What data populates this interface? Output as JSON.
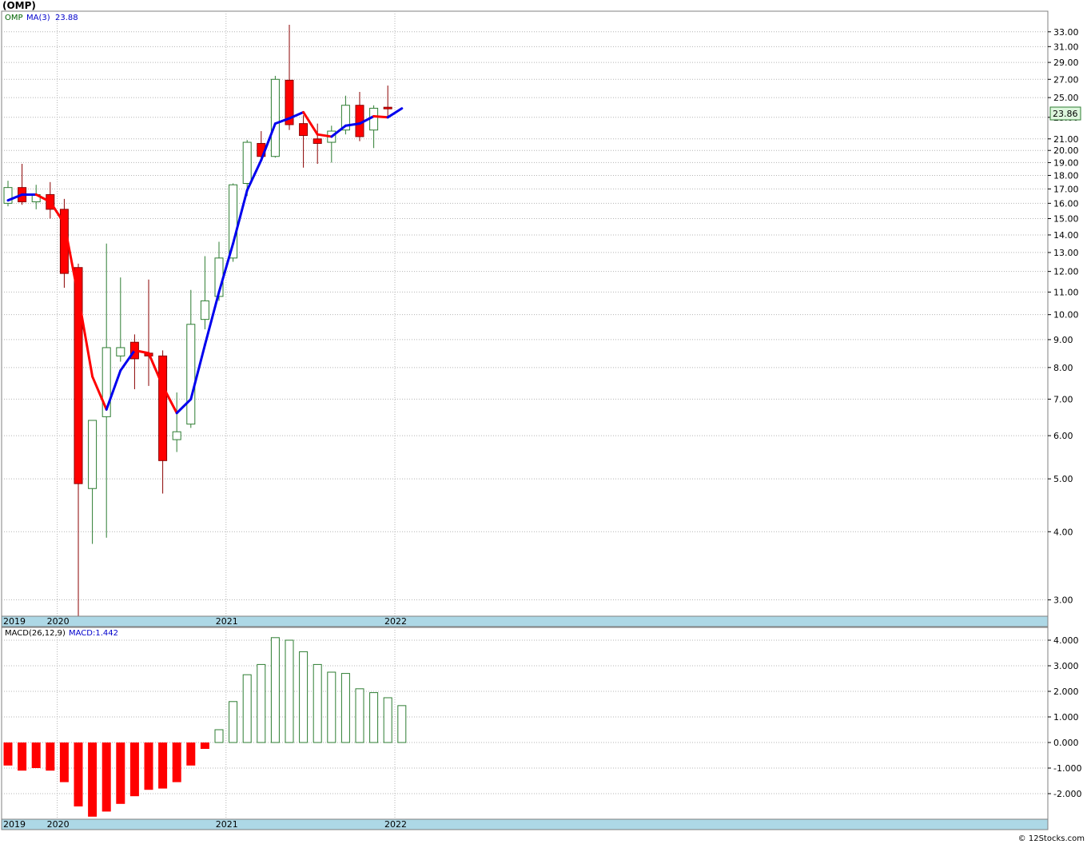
{
  "title": "(OMP)",
  "price_panel": {
    "symbol_label": "OMP",
    "ma_label": "MA(3)",
    "ma_value": "23.88",
    "last_price_tag": "23.86"
  },
  "macd_panel": {
    "label": "MACD(26,12,9)",
    "value_label": "MACD:1.442"
  },
  "watermark": "© 12Stocks.com",
  "colors": {
    "up_candle": "#2e7d32",
    "down_candle": "#ff0000",
    "ma_rising": "#0000ee",
    "ma_falling": "#ff0000",
    "grid": "#b4b4b4",
    "axis_band": "#add8e6",
    "price_tag_bg": "#ddf7dd"
  },
  "chart_data": [
    {
      "type": "candlestick",
      "title": "(OMP)",
      "scale": "log",
      "ylim": [
        2.8,
        36
      ],
      "y_ticks": [
        "3.00",
        "4.00",
        "5.00",
        "6.00",
        "7.00",
        "8.00",
        "9.00",
        "10.00",
        "11.00",
        "12.00",
        "13.00",
        "14.00",
        "15.00",
        "16.00",
        "17.00",
        "18.00",
        "19.00",
        "20.00",
        "21.00",
        "23.00",
        "25.00",
        "27.00",
        "29.00",
        "31.00",
        "33.00"
      ],
      "x_tick_labels": [
        {
          "label": "2019",
          "index": 0
        },
        {
          "label": "2020",
          "index": 3.5
        },
        {
          "label": "2021",
          "index": 15.5
        },
        {
          "label": "2022",
          "index": 27.5
        }
      ],
      "candles": [
        {
          "date": "2019-10",
          "open": 16.0,
          "high": 17.6,
          "low": 15.8,
          "close": 17.1
        },
        {
          "date": "2019-11",
          "open": 17.1,
          "high": 18.9,
          "low": 15.9,
          "close": 16.1
        },
        {
          "date": "2019-12",
          "open": 16.1,
          "high": 17.3,
          "low": 15.6,
          "close": 16.6
        },
        {
          "date": "2020-01",
          "open": 16.6,
          "high": 17.5,
          "low": 15.0,
          "close": 15.6
        },
        {
          "date": "2020-02",
          "open": 15.6,
          "high": 16.3,
          "low": 11.2,
          "close": 11.9
        },
        {
          "date": "2020-03",
          "open": 12.2,
          "high": 12.4,
          "low": 2.8,
          "close": 4.9
        },
        {
          "date": "2020-04",
          "open": 4.8,
          "high": 6.4,
          "low": 3.8,
          "close": 6.4
        },
        {
          "date": "2020-05",
          "open": 6.5,
          "high": 13.5,
          "low": 3.9,
          "close": 8.7
        },
        {
          "date": "2020-06",
          "open": 8.4,
          "high": 11.7,
          "low": 8.2,
          "close": 8.7
        },
        {
          "date": "2020-07",
          "open": 8.9,
          "high": 9.2,
          "low": 7.3,
          "close": 8.3
        },
        {
          "date": "2020-08",
          "open": 8.5,
          "high": 11.6,
          "low": 7.4,
          "close": 8.4
        },
        {
          "date": "2020-09",
          "open": 8.4,
          "high": 8.6,
          "low": 4.7,
          "close": 5.4
        },
        {
          "date": "2020-10",
          "open": 5.9,
          "high": 7.2,
          "low": 5.6,
          "close": 6.1
        },
        {
          "date": "2020-11",
          "open": 6.3,
          "high": 11.1,
          "low": 6.2,
          "close": 9.6
        },
        {
          "date": "2020-12",
          "open": 9.8,
          "high": 12.8,
          "low": 9.4,
          "close": 10.6
        },
        {
          "date": "2021-01",
          "open": 10.8,
          "high": 13.6,
          "low": 10.6,
          "close": 12.7
        },
        {
          "date": "2021-02",
          "open": 12.7,
          "high": 17.4,
          "low": 12.5,
          "close": 17.3
        },
        {
          "date": "2021-03",
          "open": 17.4,
          "high": 20.9,
          "low": 16.5,
          "close": 20.7
        },
        {
          "date": "2021-04",
          "open": 20.6,
          "high": 21.7,
          "low": 19.3,
          "close": 19.5
        },
        {
          "date": "2021-05",
          "open": 19.5,
          "high": 27.4,
          "low": 19.4,
          "close": 27.0
        },
        {
          "date": "2021-06",
          "open": 26.9,
          "high": 34.0,
          "low": 21.8,
          "close": 22.3
        },
        {
          "date": "2021-07",
          "open": 22.4,
          "high": 23.2,
          "low": 18.6,
          "close": 21.3
        },
        {
          "date": "2021-08",
          "open": 21.0,
          "high": 22.4,
          "low": 18.9,
          "close": 20.6
        },
        {
          "date": "2021-09",
          "open": 20.7,
          "high": 22.2,
          "low": 19.0,
          "close": 21.7
        },
        {
          "date": "2021-10",
          "open": 21.8,
          "high": 25.2,
          "low": 21.4,
          "close": 24.2
        },
        {
          "date": "2021-11",
          "open": 24.2,
          "high": 25.6,
          "low": 20.8,
          "close": 21.2
        },
        {
          "date": "2021-12",
          "open": 21.8,
          "high": 24.2,
          "low": 20.2,
          "close": 23.9
        },
        {
          "date": "2022-01",
          "open": 24.0,
          "high": 26.3,
          "low": 23.0,
          "close": 23.86
        }
      ],
      "ma3": [
        16.2,
        16.6,
        16.6,
        16.1,
        14.7,
        10.8,
        7.7,
        6.7,
        7.9,
        8.6,
        8.5,
        7.4,
        6.6,
        7.0,
        8.8,
        11.0,
        13.5,
        16.9,
        19.2,
        22.4,
        22.9,
        23.5,
        21.4,
        21.2,
        22.2,
        22.4,
        23.1,
        23.0,
        23.88
      ]
    },
    {
      "type": "bar",
      "title": "MACD(26,12,9)",
      "ylim": [
        -3.0,
        4.5
      ],
      "y_ticks": [
        "-2.000",
        "-1.000",
        "0.000",
        "1.000",
        "2.000",
        "3.000",
        "4.000"
      ],
      "x_tick_labels": [
        {
          "label": "2019",
          "index": 0
        },
        {
          "label": "2020",
          "index": 3.5
        },
        {
          "label": "2021",
          "index": 15.5
        },
        {
          "label": "2022",
          "index": 27.5
        }
      ],
      "values": [
        -0.9,
        -1.1,
        -1.0,
        -1.1,
        -1.55,
        -2.5,
        -2.9,
        -2.7,
        -2.4,
        -2.1,
        -1.85,
        -1.8,
        -1.55,
        -0.9,
        -0.25,
        0.5,
        1.6,
        2.65,
        3.05,
        4.1,
        4.0,
        3.55,
        3.05,
        2.75,
        2.7,
        2.1,
        1.95,
        1.75,
        1.442
      ]
    }
  ]
}
